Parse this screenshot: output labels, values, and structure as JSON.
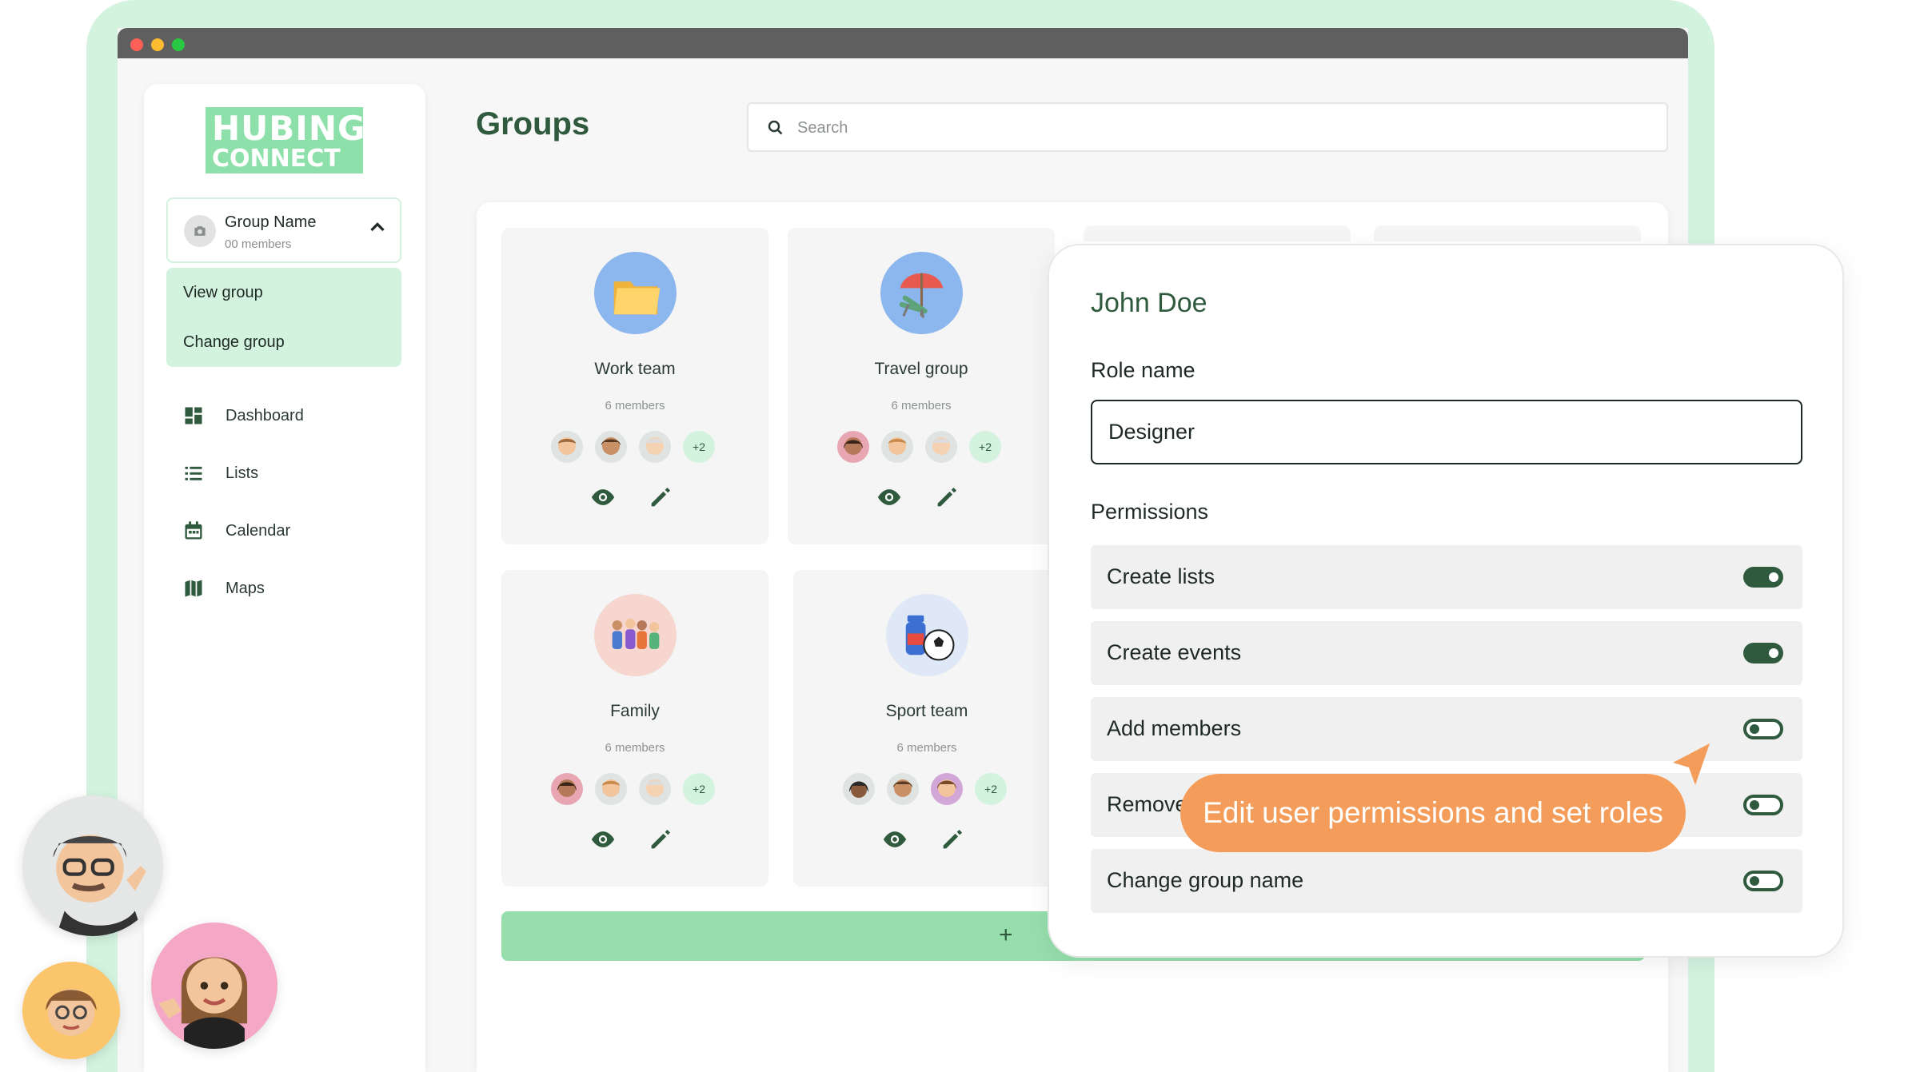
{
  "colors": {
    "brand_green": "#8ee0aa",
    "brand_light": "#d3f3df",
    "dark_green": "#2f5a3e",
    "callout_orange": "#f49c59",
    "dot_red": "#fe5f57",
    "dot_yellow": "#febc2e",
    "dot_green": "#28c840"
  },
  "logo": {
    "line1": "HUBING",
    "line2": "CONNECT"
  },
  "group_selector": {
    "name": "Group Name",
    "members": "00 members",
    "icon": "camera-icon",
    "menu": [
      "View group",
      "Change group"
    ]
  },
  "nav": [
    {
      "label": "Dashboard",
      "icon": "dashboard-icon"
    },
    {
      "label": "Lists",
      "icon": "list-icon"
    },
    {
      "label": "Calendar",
      "icon": "calendar-icon"
    },
    {
      "label": "Maps",
      "icon": "map-icon"
    }
  ],
  "page": {
    "title": "Groups"
  },
  "search": {
    "placeholder": "Search"
  },
  "groups": [
    {
      "name": "Work team",
      "members": "6 members",
      "more": "+2",
      "icon": "folder-icon"
    },
    {
      "name": "Travel group",
      "members": "6 members",
      "more": "+2",
      "icon": "beach-chair-icon"
    },
    {
      "name": "Family",
      "members": "6 members",
      "more": "+2",
      "icon": "family-icon"
    },
    {
      "name": "Sport team",
      "members": "6 members",
      "more": "+2",
      "icon": "sport-ball-icon"
    }
  ],
  "add_group": {
    "plus": "+",
    "label": ""
  },
  "panel": {
    "user_name": "John Doe",
    "role_label": "Role name",
    "role_value": "Designer",
    "permissions_label": "Permissions",
    "permissions": [
      {
        "label": "Create lists",
        "enabled": true
      },
      {
        "label": "Create events",
        "enabled": true
      },
      {
        "label": "Add members",
        "enabled": false
      },
      {
        "label": "Remove",
        "enabled": false
      },
      {
        "label": "Change group name",
        "enabled": false
      }
    ]
  },
  "callout": {
    "text": "Edit user permissions and set roles"
  }
}
